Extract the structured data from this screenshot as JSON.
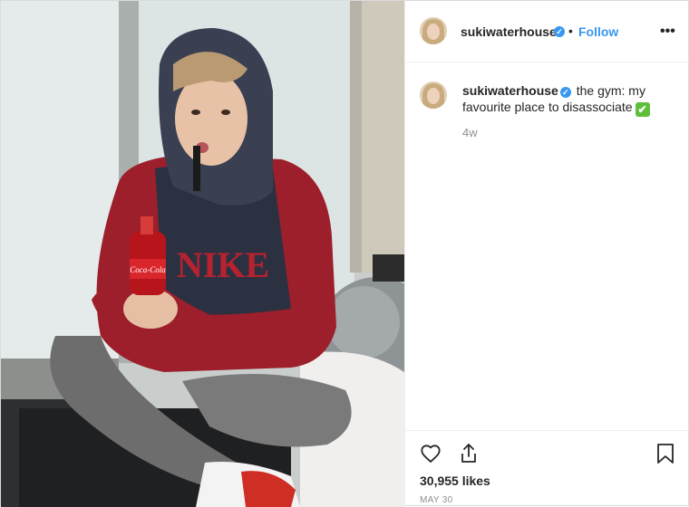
{
  "post": {
    "author": {
      "username": "sukiwaterhouse",
      "verified": true
    },
    "follow_label": "Follow",
    "separator": "•",
    "more_label": "•••",
    "caption": {
      "username": "sukiwaterhouse",
      "text": "the gym: my favourite place to disassociate",
      "emoji": "✔",
      "time": "4w"
    },
    "likes": "30,955 likes",
    "date": "MAY 30"
  },
  "photo": {
    "shirt_text": "NIKE",
    "bottle_text": "Coca-Cola"
  },
  "icons": {
    "like": "heart-icon",
    "share": "share-icon",
    "save": "bookmark-icon",
    "verified": "verified-badge-icon"
  },
  "colors": {
    "link_blue": "#3897f0",
    "text": "#262626",
    "muted": "#8e8e8e",
    "border": "#efefef"
  }
}
